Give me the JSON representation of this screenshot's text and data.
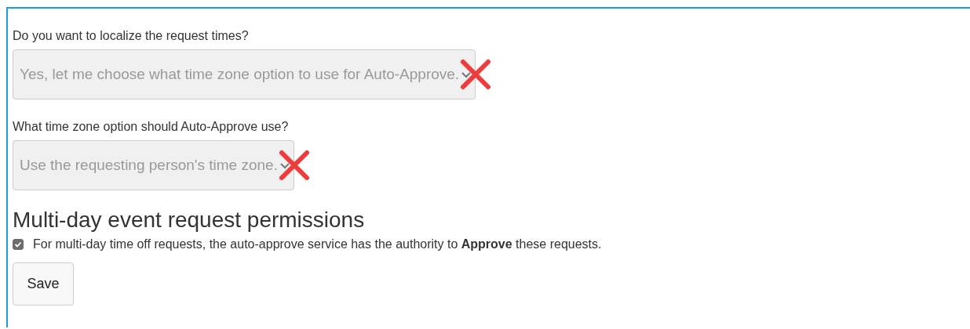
{
  "fields": [
    {
      "label": "Do you want to localize the request times?",
      "value": "Yes, let me choose what time zone option to use for Auto-Approve.",
      "disabled": true,
      "crossed_out": true
    },
    {
      "label": "What time zone option should Auto-Approve use?",
      "value": "Use the requesting person's time zone.",
      "disabled": true,
      "crossed_out": true
    }
  ],
  "section": {
    "title": "Multi-day event request permissions"
  },
  "checkbox": {
    "label": "For multi-day time off requests, the auto-approve service has the authority to **Approve** these requests.",
    "checked": true
  },
  "buttons": [
    "Save"
  ]
}
